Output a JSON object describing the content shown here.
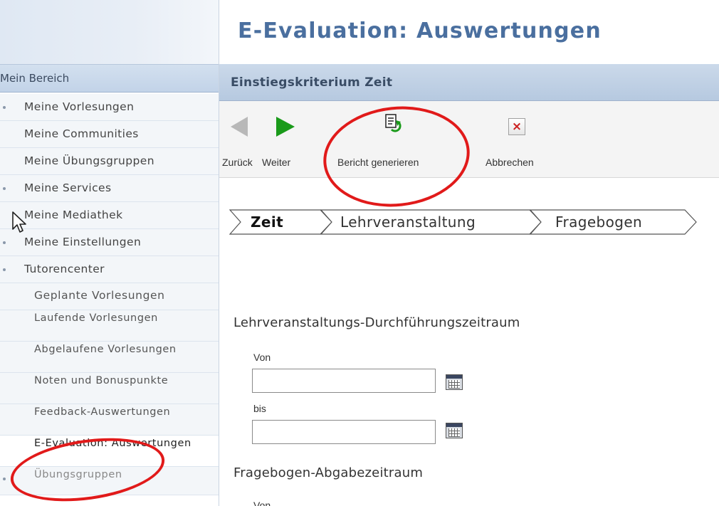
{
  "sidebar": {
    "header": "Mein Bereich",
    "items": [
      {
        "label": "Meine Vorlesungen"
      },
      {
        "label": "Meine Communities"
      },
      {
        "label": "Meine Übungsgruppen"
      },
      {
        "label": "Meine Services"
      },
      {
        "label": "Meine Mediathek"
      },
      {
        "label": "Meine Einstellungen"
      },
      {
        "label": "Tutorencenter"
      }
    ],
    "subitems": [
      {
        "label": "Geplante Vorlesungen"
      },
      {
        "label": "Laufende Vorlesungen"
      },
      {
        "label": "Abgelaufene Vorlesungen"
      },
      {
        "label": "Noten und Bonuspunkte"
      },
      {
        "label": "Feedback-Auswertungen"
      },
      {
        "label": "E-Evaluation: Auswertungen"
      },
      {
        "label": "Übungsgruppen"
      }
    ]
  },
  "main": {
    "title": "E-Evaluation: Auswertungen",
    "step_title": "Einstiegskriterium Zeit",
    "toolbar": {
      "back_label": "Zurück",
      "next_label": "Weiter",
      "report_label": "Bericht generieren",
      "cancel_label": "Abbrechen"
    },
    "steps": [
      {
        "label": "Zeit",
        "active": true
      },
      {
        "label": "Lehrveranstaltung",
        "active": false
      },
      {
        "label": "Fragebogen",
        "active": false
      }
    ],
    "form": {
      "section1_label": "Lehrveranstaltungs-Durchführungszeitraum",
      "from_label": "Von",
      "to_label": "bis",
      "from_value": "",
      "to_value": "",
      "section2_label": "Fragebogen-Abgabezeitraum",
      "from2_label": "Von"
    }
  },
  "icons": {
    "back": "arrow-left-icon",
    "next": "arrow-right-icon",
    "report": "generate-report-icon",
    "cancel": "close-icon",
    "calendar": "calendar-icon",
    "cursor": "mouse-cursor-icon"
  },
  "colors": {
    "title": "#4a6f9f",
    "annotation": "#e11a1a",
    "next_arrow": "#1a9a1a"
  }
}
